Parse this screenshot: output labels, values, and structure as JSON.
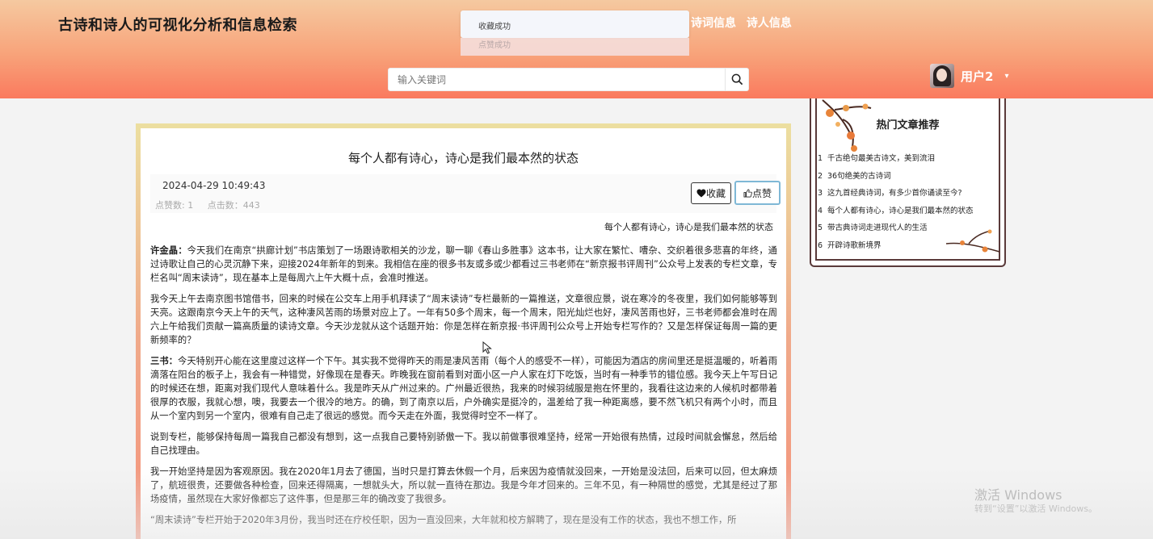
{
  "header": {
    "site_title": "古诗和诗人的可视化分析和信息检索",
    "nav": [
      "诗词信息",
      "诗人信息"
    ],
    "toasts": [
      "收藏成功",
      "点赞成功"
    ],
    "search_placeholder": "输入关键词",
    "user_name": "用户2",
    "user_caret": "▾"
  },
  "article": {
    "title": "每个人都有诗心，诗心是我们最本然的状态",
    "date": "2024-04-29 10:49:43",
    "likes_text": "点赞数:  1",
    "clicks_text": "点击数：443",
    "fav_label": "收藏",
    "like_label": "点赞",
    "subtitle": "每个人都有诗心，诗心是我们最本然的状态",
    "paragraphs": [
      {
        "speaker": "许金晶：",
        "text": "今天我们在南京“拱廊计划”书店策划了一场跟诗歌相关的沙龙，聊一聊《春山多胜事》这本书，让大家在繁忙、嘈杂、交织着很多悲喜的年终，通过诗歌让自己的心灵沉静下来，迎接2024年新年的到来。我相信在座的很多书友或多或少都看过三书老师在“新京报书评周刊”公众号上发表的专栏文章，专栏名叫“周末读诗”，现在基本上是每周六上午大概十点，会准时推送。"
      },
      {
        "speaker": "",
        "text": "我今天上午去南京图书馆借书，回来的时候在公交车上用手机拜读了“周末读诗”专栏最新的一篇推送，文章很应景，说在寒冷的冬夜里，我们如何能够等到天亮。这跟南京今天上午的天气，这种凄风苦雨的场景对应上了。一年有50多个周末，每一个周末，阳光灿烂也好，凄风苦雨也好，三书老师都会准时在周六上午给我们贡献一篇高质量的读诗文章。今天沙龙就从这个话题开始：你是怎样在新京报·书评周刊公众号上开始专栏写作的？又是怎样保证每周一篇的更新频率的？"
      },
      {
        "speaker": "三书：",
        "text": "今天特别开心能在这里度过这样一个下午。其实我不觉得昨天的雨是凄风苦雨（每个人的感受不一样），可能因为酒店的房间里还是挺温暖的，听着雨滴落在阳台的板子上，我会有一种错觉，好像现在是春天。昨晚我在窗前看到对面小区一户人家在灯下吃饭，当时有一种季节的错位感。我今天上午写日记的时候还在想，距离对我们现代人意味着什么。我是昨天从广州过来的。广州最近很热，我来的时候羽绒服是抱在怀里的，我看往这边来的人候机时都带着很厚的衣服，我就心想，噢，我要去一个很冷的地方。的确，到了南京以后，户外确实是挺冷的，温差给了我一种距离感，要不然飞机只有两个小时，而且从一个室内到另一个室内，很难有自己走了很远的感觉。而今天走在外面，我觉得时空不一样了。"
      },
      {
        "speaker": "",
        "text": "说到专栏，能够保持每周一篇我自己都没有想到，这一点我自己要特别骄傲一下。我以前做事很难坚持，经常一开始很有热情，过段时间就会懈怠，然后给自己找理由。"
      },
      {
        "speaker": "",
        "text": "我一开始坚持是因为客观原因。我在2020年1月去了德国，当时只是打算去休假一个月，后来因为疫情就没回来，一开始是没法回，后来可以回，但太麻烦了，航班很贵，还要做各种检查，回来还得隔离，一想就头大，所以就一直待在那边。我是今年才回来的。三年不见，有一种隔世的感觉，尤其是经过了那场疫情，虽然现在大家好像都忘了这件事，但是那三年的确改变了我很多。"
      },
      {
        "speaker": "",
        "text": "“周末读诗”专栏开始于2020年3月份，我当时还在疗校任职，因为一直没回来，大年就和校方解聘了，现在是没有工作的状态，我也不想工作，所"
      }
    ]
  },
  "hot": {
    "title": "热门文章推荐",
    "items": [
      {
        "n": "1",
        "text": "千古绝句最美古诗文，美到流泪"
      },
      {
        "n": "2",
        "text": "36句绝美的古诗词"
      },
      {
        "n": "3",
        "text": "这九首经典诗词，有多少首你诵读至今?"
      },
      {
        "n": "4",
        "text": "每个人都有诗心，诗心是我们最本然的状态"
      },
      {
        "n": "5",
        "text": "带古典诗词走进现代人的生活"
      },
      {
        "n": "6",
        "text": "开辟诗歌新境界"
      }
    ]
  },
  "watermark": {
    "line1": "激活 Windows",
    "line2": "转到“设置”以激活 Windows。"
  }
}
